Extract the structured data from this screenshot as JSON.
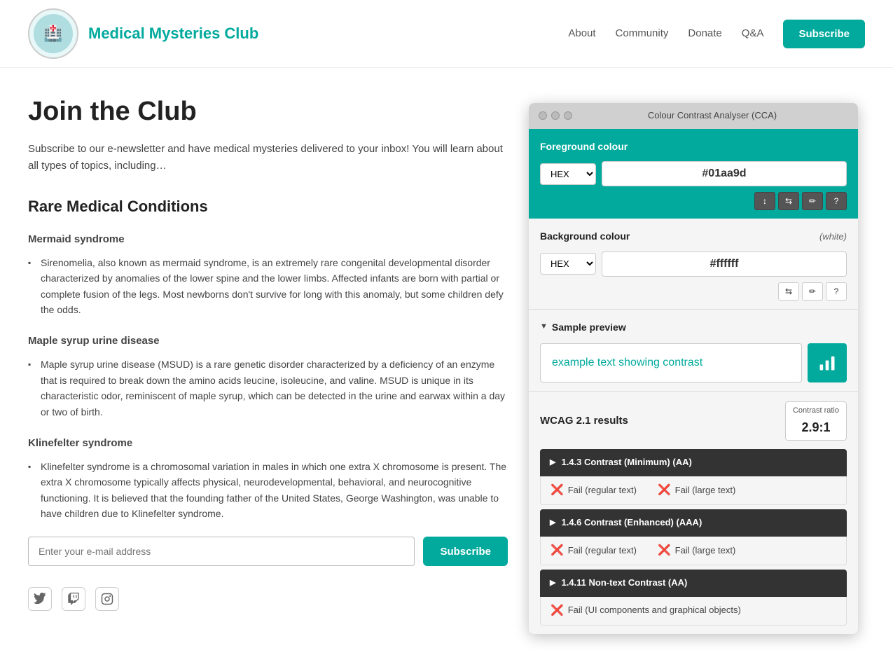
{
  "header": {
    "site_title": "Medical Mysteries Club",
    "nav": {
      "about": "About",
      "community": "Community",
      "donate": "Donate",
      "qa": "Q&A",
      "subscribe": "Subscribe"
    },
    "logo_emoji": "🏥"
  },
  "main": {
    "heading": "Join the Club",
    "intro": "Subscribe to our e-newsletter and have medical mysteries delivered to your inbox! You will learn about all types of topics, including…",
    "rare_conditions_heading": "Rare Medical Conditions",
    "conditions": [
      {
        "title": "Mermaid syndrome",
        "description": "Sirenomelia, also known as mermaid syndrome, is an extremely rare congenital developmental disorder characterized by anomalies of the lower spine and the lower limbs. Affected infants are born with partial or complete fusion of the legs. Most newborns don't survive for long with this anomaly, but some children defy the odds."
      },
      {
        "title": "Maple syrup urine disease",
        "description": "Maple syrup urine disease (MSUD) is a rare genetic disorder characterized by a deficiency of an enzyme that is required to break down the amino acids leucine, isoleucine, and valine. MSUD is unique in its characteristic odor, reminiscent of maple syrup, which can be detected in the urine and earwax within a day or two of birth."
      },
      {
        "title": "Klinefelter syndrome",
        "description": "Klinefelter syndrome is a chromosomal variation in males in which one extra X chromosome is present. The extra X chromosome typically affects physical, neurodevelopmental, behavioral, and neurocognitive functioning. It is believed that the founding father of the United States, George Washington, was unable to have children due to Klinefelter syndrome."
      }
    ],
    "email_placeholder": "Enter your e-mail address",
    "subscribe_label": "Subscribe"
  },
  "cca": {
    "title": "Colour Contrast Analyser (CCA)",
    "fg_label": "Foreground colour",
    "fg_format": "HEX",
    "fg_value": "#01aa9d",
    "bg_label": "Background colour",
    "bg_white": "(white)",
    "bg_format": "HEX",
    "bg_value": "#ffffff",
    "sample_label": "Sample preview",
    "sample_text": "example text showing contrast",
    "wcag_label": "WCAG 2.1 results",
    "contrast_ratio_label": "Contrast ratio",
    "contrast_ratio_value": "2.9:1",
    "criteria": [
      {
        "id": "1.4.3",
        "label": "1.4.3 Contrast (Minimum) (AA)",
        "result1": "Fail (regular text)",
        "result2": "Fail (large text)"
      },
      {
        "id": "1.4.6",
        "label": "1.4.6 Contrast (Enhanced) (AAA)",
        "result1": "Fail (regular text)",
        "result2": "Fail (large text)"
      },
      {
        "id": "1.4.11",
        "label": "1.4.11 Non-text Contrast (AA)",
        "result1": "Fail (UI components and graphical objects)",
        "result2": null
      }
    ],
    "tools": {
      "fg_tools": [
        "↕",
        "⇆",
        "✏",
        "?"
      ],
      "bg_tools": [
        "⇆",
        "✏",
        "?"
      ]
    }
  }
}
